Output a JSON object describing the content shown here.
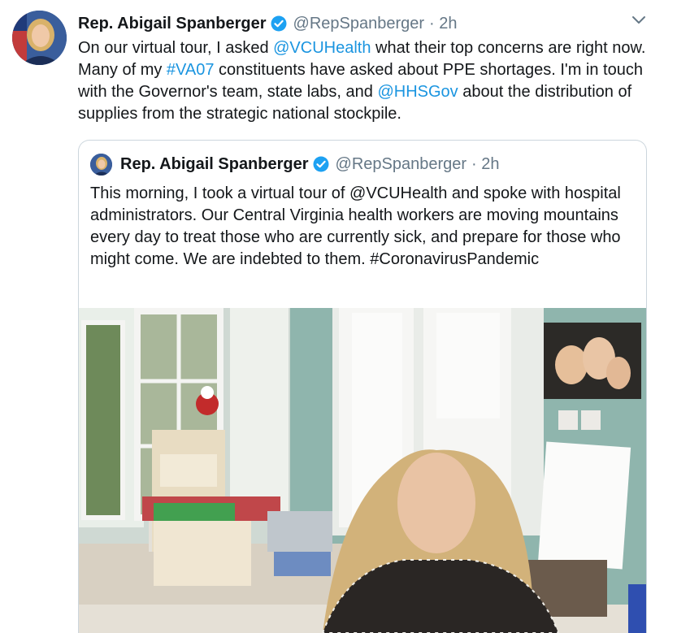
{
  "tweet": {
    "author_name": "Rep. Abigail Spanberger",
    "handle": "@RepSpanberger",
    "time": "· 2h",
    "text_parts": [
      {
        "t": "On our virtual tour, I asked ",
        "link": false
      },
      {
        "t": "@VCUHealth",
        "link": true
      },
      {
        "t": " what their top concerns are right now. Many of my ",
        "link": false
      },
      {
        "t": "#VA07",
        "link": true
      },
      {
        "t": " constituents have asked about PPE shortages. I'm in touch with the Governor's team, state labs, and ",
        "link": false
      },
      {
        "t": "@HHSGov",
        "link": true
      },
      {
        "t": " about the distribution of supplies from the strategic national stockpile.",
        "link": false
      }
    ]
  },
  "quoted": {
    "author_name": "Rep. Abigail Spanberger",
    "handle": "@RepSpanberger",
    "time": "· 2h",
    "text": "This morning, I took a virtual tour of @VCUHealth and spoke with hospital administrators. Our Central Virginia health workers are moving mountains every day to treat those who are currently sick, and prepare for those who might come. We are indebted to them. #CoronavirusPandemic"
  },
  "colors": {
    "link": "#1b95e0",
    "secondary_text": "#657786",
    "verified_badge": "#1da1f2",
    "border": "#ccd6dd"
  },
  "icons": {
    "verified": "verified-badge-icon",
    "caret": "chevron-down-icon"
  }
}
